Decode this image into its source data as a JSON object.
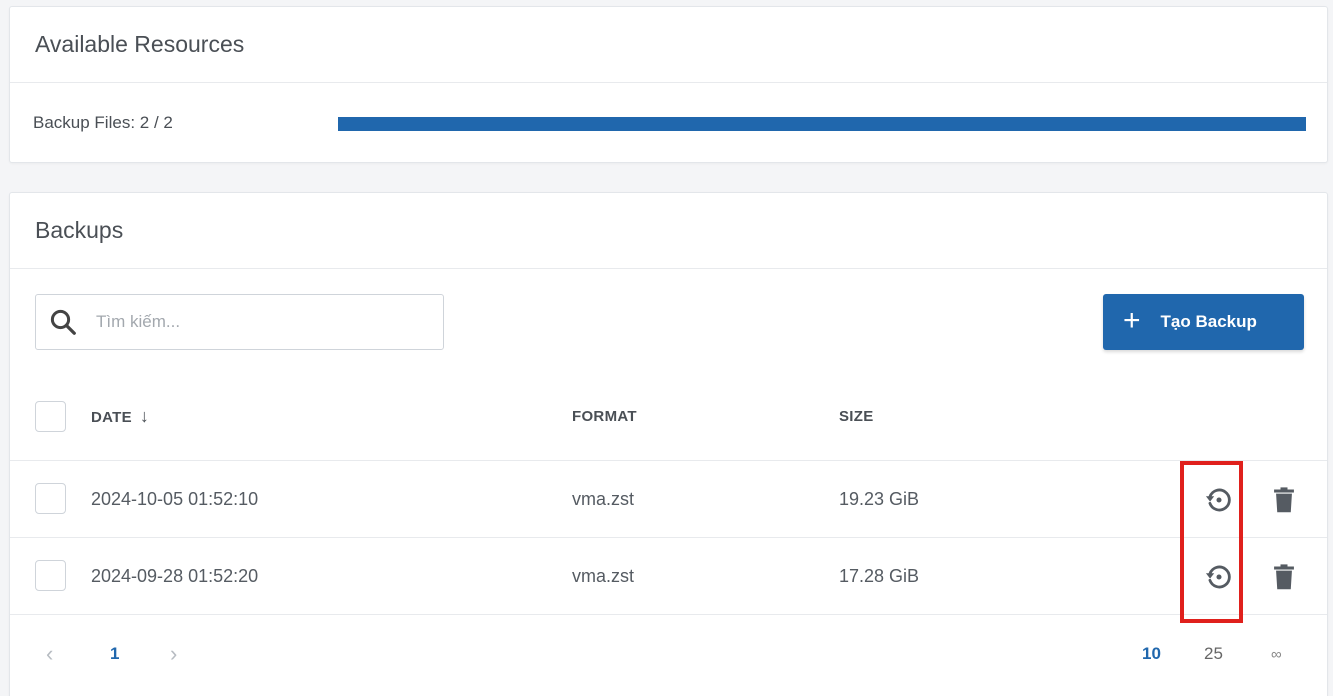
{
  "resources": {
    "title": "Available Resources",
    "backup_files_label": "Backup Files: 2 / 2",
    "backup_files_used": 2,
    "backup_files_total": 2
  },
  "backups": {
    "title": "Backups",
    "search": {
      "placeholder": "Tìm kiếm...",
      "value": ""
    },
    "create_button": "Tạo Backup",
    "columns": {
      "date": "DATE",
      "format": "FORMAT",
      "size": "SIZE"
    },
    "sort_indicator": "↓",
    "rows": [
      {
        "date": "2024-10-05 01:52:10",
        "format": "vma.zst",
        "size": "19.23 GiB"
      },
      {
        "date": "2024-09-28 01:52:20",
        "format": "vma.zst",
        "size": "17.28 GiB"
      }
    ],
    "pagination": {
      "prev": "‹",
      "current_page": "1",
      "next": "›",
      "page_sizes": [
        "10",
        "25",
        "∞"
      ],
      "selected_page_size": "10"
    }
  },
  "colors": {
    "accent": "#2067ad",
    "highlight": "#e0201c",
    "icon": "#555b62"
  }
}
